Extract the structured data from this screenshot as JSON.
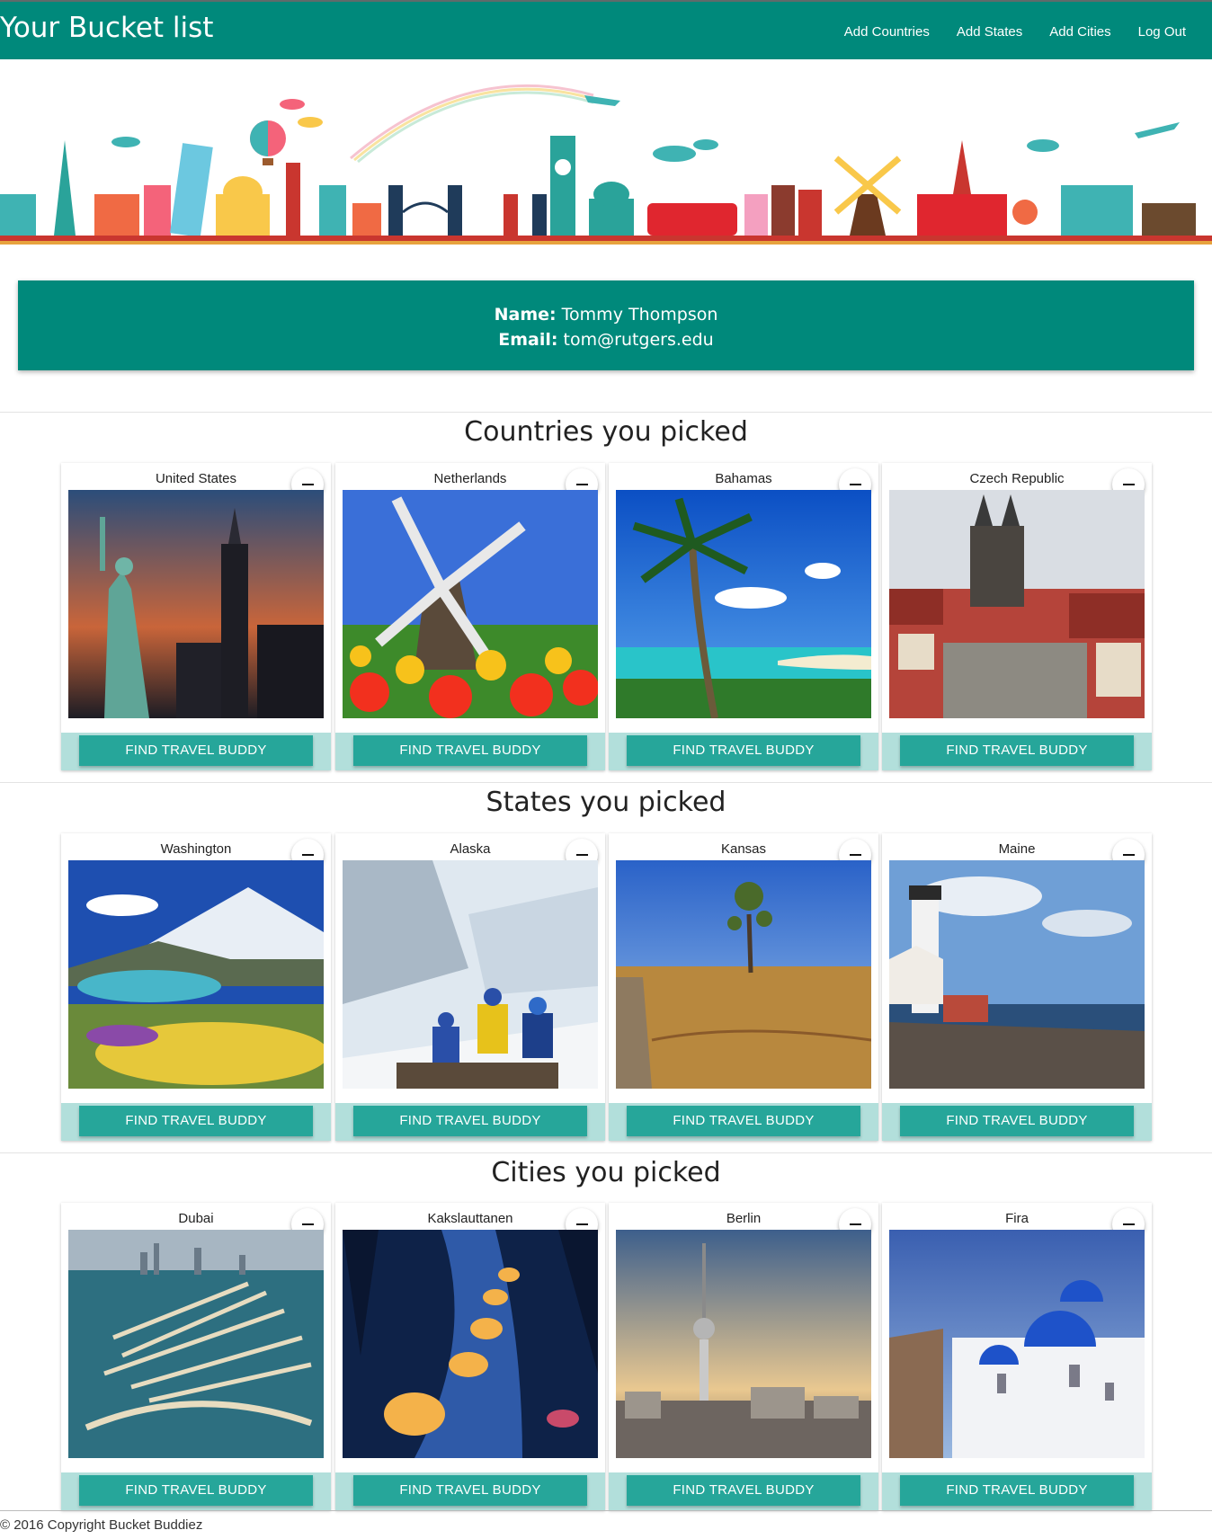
{
  "navbar": {
    "brand": "Your Bucket list",
    "links": [
      "Add Countries",
      "Add States",
      "Add Cities",
      "Log Out"
    ]
  },
  "profile": {
    "name_label": "Name:",
    "name": "Tommy Thompson",
    "email_label": "Email:",
    "email": "tom@rutgers.edu"
  },
  "sections": [
    {
      "title": "Countries you picked",
      "items": [
        {
          "name": "United States",
          "button": "FIND TRAVEL BUDDY"
        },
        {
          "name": "Netherlands",
          "button": "FIND TRAVEL BUDDY"
        },
        {
          "name": "Bahamas",
          "button": "FIND TRAVEL BUDDY"
        },
        {
          "name": "Czech Republic",
          "button": "FIND TRAVEL BUDDY"
        }
      ]
    },
    {
      "title": "States you picked",
      "items": [
        {
          "name": "Washington",
          "button": "FIND TRAVEL BUDDY"
        },
        {
          "name": "Alaska",
          "button": "FIND TRAVEL BUDDY"
        },
        {
          "name": "Kansas",
          "button": "FIND TRAVEL BUDDY"
        },
        {
          "name": "Maine",
          "button": "FIND TRAVEL BUDDY"
        }
      ]
    },
    {
      "title": "Cities you picked",
      "items": [
        {
          "name": "Dubai",
          "button": "FIND TRAVEL BUDDY"
        },
        {
          "name": "Kakslauttanen",
          "button": "FIND TRAVEL BUDDY"
        },
        {
          "name": "Berlin",
          "button": "FIND TRAVEL BUDDY"
        },
        {
          "name": "Fira",
          "button": "FIND TRAVEL BUDDY"
        }
      ]
    }
  ],
  "footer": {
    "copyright": "© 2016 Copyright Bucket Buddiez"
  },
  "colors": {
    "primary": "#00897b",
    "button": "#26a69a",
    "card_footer": "#b2dfdb"
  }
}
